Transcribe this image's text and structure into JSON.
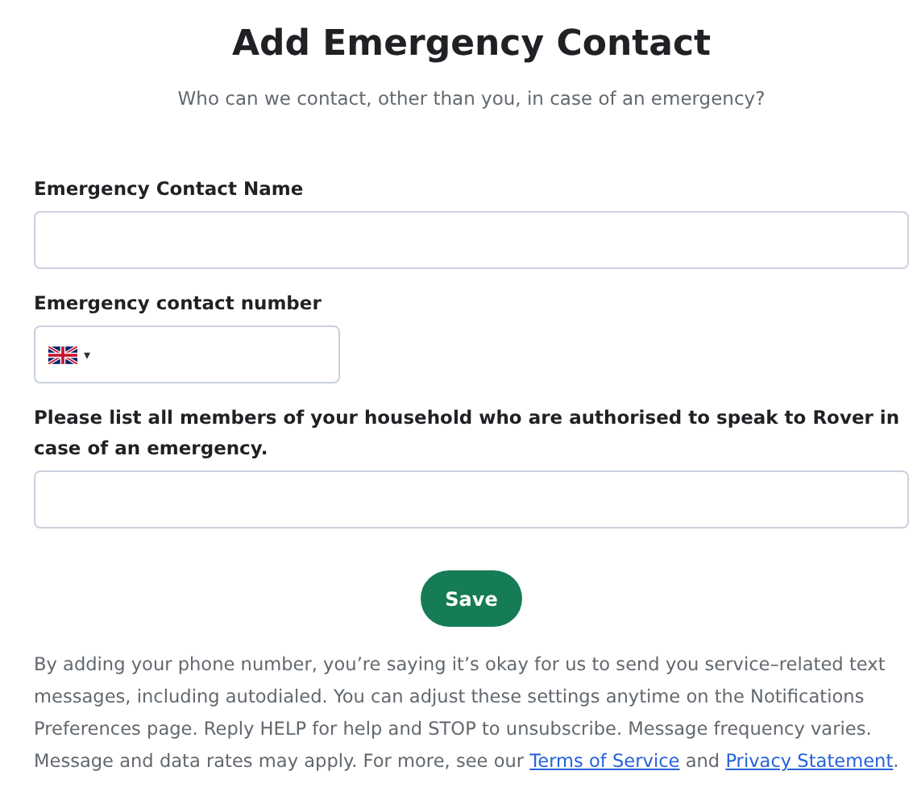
{
  "title": "Add Emergency Contact",
  "subtitle": "Who can we contact, other than you, in case of an emergency?",
  "fields": [
    {
      "kind": "text",
      "label": "Emergency Contact Name"
    },
    {
      "kind": "phone",
      "label": "Emergency contact number",
      "country_caret": "▾"
    },
    {
      "kind": "text",
      "label": "Please list all members of your household who are authorised to speak to Rover in case of an emergency."
    }
  ],
  "save_button": "Save",
  "disclaimer": {
    "text": "By adding your phone number, you’re saying it’s okay for us to send you service–related text messages, including autodialed. You can adjust these settings anytime on the Notifications Preferences page. Reply HELP for help and STOP to unsubscribe. Message frequency varies. Message and data rates may apply. For more, see our ",
    "links": [
      "Terms of Service",
      "Privacy Statement"
    ],
    "between": " and ",
    "end": "."
  }
}
